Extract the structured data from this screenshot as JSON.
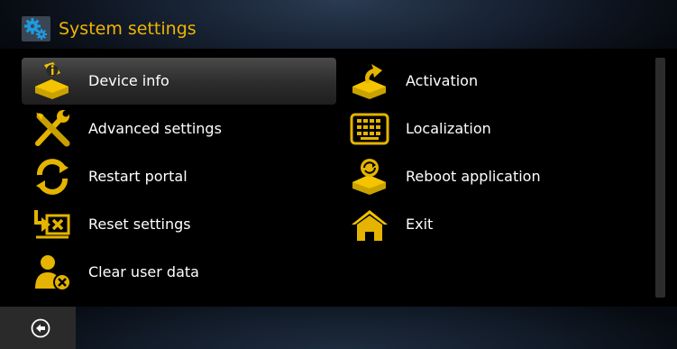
{
  "header": {
    "title": "System settings",
    "icon": "gears-icon"
  },
  "colors": {
    "accent": "#f0b400",
    "text": "#ffffff",
    "selected_bg": "#3a3a3a"
  },
  "menu": {
    "left": [
      {
        "label": "Device info",
        "icon": "device-info-icon",
        "selected": true
      },
      {
        "label": "Advanced settings",
        "icon": "tools-icon"
      },
      {
        "label": "Restart portal",
        "icon": "restart-icon"
      },
      {
        "label": "Reset settings",
        "icon": "reset-icon"
      },
      {
        "label": "Clear user data",
        "icon": "clear-user-icon"
      }
    ],
    "right": [
      {
        "label": "Activation",
        "icon": "activation-icon"
      },
      {
        "label": "Localization",
        "icon": "keyboard-icon"
      },
      {
        "label": "Reboot application",
        "icon": "reboot-icon"
      },
      {
        "label": "Exit",
        "icon": "home-icon"
      }
    ]
  },
  "footer": {
    "back_icon": "back-icon"
  }
}
